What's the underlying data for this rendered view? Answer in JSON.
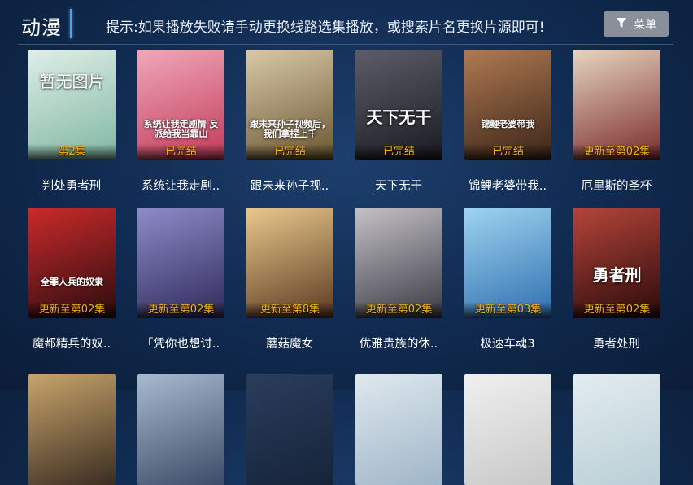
{
  "header": {
    "section_title": "动漫",
    "notice": "提示:如果播放失败请手动更换线路选集播放，或搜索片名更换片源即可!",
    "menu_icon": "filter-icon",
    "menu_label": "菜单"
  },
  "rows": [
    [
      {
        "title": "判处勇者刑",
        "status": "第2集",
        "art_text": "暂无图片",
        "colors": [
          "#dfeee8",
          "#7fb7a2"
        ]
      },
      {
        "title": "系统让我走剧..",
        "status": "已完结",
        "art_text": "系统让我走剧情 反派给我当靠山",
        "colors": [
          "#f0a8b8",
          "#c23a5a"
        ]
      },
      {
        "title": "跟未来孙子视..",
        "status": "已完结",
        "art_text": "跟未来孙子视频后，我们拿捏上千",
        "colors": [
          "#d9c9a7",
          "#6b5533"
        ]
      },
      {
        "title": "天下无干",
        "status": "已完结",
        "art_text": "天下无干",
        "colors": [
          "#5d5d6a",
          "#1a1a22"
        ]
      },
      {
        "title": "锦鲤老婆带我..",
        "status": "已完结",
        "art_text": "锦鲤老婆带我",
        "colors": [
          "#b07a52",
          "#3a2418"
        ]
      },
      {
        "title": "厄里斯的圣杯",
        "status": "更新至第02集",
        "art_text": "",
        "colors": [
          "#e6d6c0",
          "#7a2a2a"
        ]
      }
    ],
    [
      {
        "title": "魔都精兵的奴..",
        "status": "更新至第02集",
        "art_text": "全罪人兵的奴隶",
        "colors": [
          "#cc2a2a",
          "#2a0c10"
        ]
      },
      {
        "title": "「凭你也想讨..",
        "status": "更新至第02集",
        "art_text": "",
        "colors": [
          "#8e8cc9",
          "#2f2a5c"
        ]
      },
      {
        "title": "蘑菇魔女",
        "status": "更新至第8集",
        "art_text": "",
        "colors": [
          "#e9c98c",
          "#5d3a22"
        ]
      },
      {
        "title": "优雅贵族的休..",
        "status": "更新至第02集",
        "art_text": "",
        "colors": [
          "#c4c2c6",
          "#3b3a44"
        ]
      },
      {
        "title": "极速车魂3",
        "status": "更新至第03集",
        "art_text": "",
        "colors": [
          "#9fd4f0",
          "#2e6fb0"
        ]
      },
      {
        "title": "勇者处刑",
        "status": "更新至第02集",
        "art_text": "勇者刑",
        "colors": [
          "#b5453a",
          "#2a0a0a"
        ]
      }
    ],
    [
      {
        "colors": [
          "#c9a46b",
          "#3a2d22"
        ]
      },
      {
        "colors": [
          "#a8b9d0",
          "#3c4c66"
        ]
      },
      {
        "colors": [
          "#2a3d5c",
          "#16243a"
        ]
      },
      {
        "colors": [
          "#dfe8ee",
          "#9fb6c8"
        ]
      },
      {
        "colors": [
          "#f0f0f0",
          "#c8c8c8"
        ]
      },
      {
        "colors": [
          "#e3ecef",
          "#b9cfd6"
        ]
      }
    ]
  ]
}
